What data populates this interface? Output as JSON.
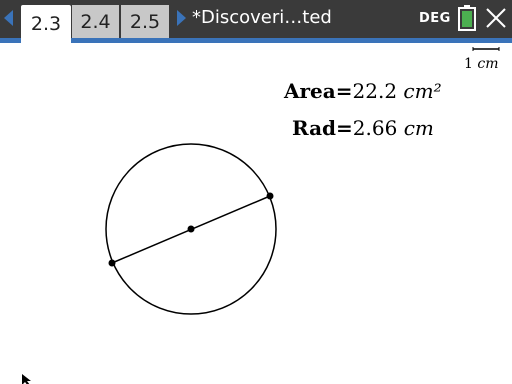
{
  "tabs": [
    {
      "label": "2.3",
      "active": true
    },
    {
      "label": "2.4",
      "active": false
    },
    {
      "label": "2.5",
      "active": false
    }
  ],
  "document_title": "*Discoveri…ted",
  "status": {
    "angle_mode": "DEG",
    "battery_icon": "battery-icon",
    "battery_color": "#4caf50"
  },
  "scale": {
    "value": "1",
    "unit": "cm"
  },
  "measurements": {
    "area": {
      "name": "Area",
      "equals": "=",
      "value": "22.2",
      "unit": "cm²"
    },
    "radius": {
      "name": "Rad",
      "equals": "=",
      "value": "2.66",
      "unit": "cm"
    }
  },
  "colors": {
    "topbar": "#3a3a3a",
    "accent": "#3a73b9"
  }
}
